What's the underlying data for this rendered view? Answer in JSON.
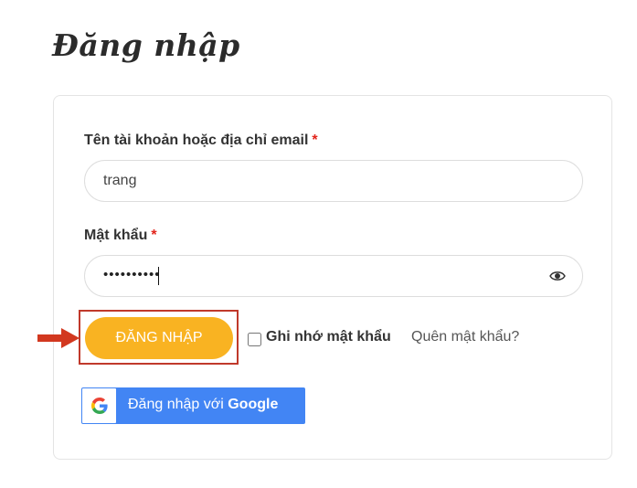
{
  "page": {
    "title": "Đăng nhập"
  },
  "form": {
    "username": {
      "label": "Tên tài khoản hoặc địa chỉ email",
      "required_mark": "*",
      "value": "trang"
    },
    "password": {
      "label": "Mật khẩu",
      "required_mark": "*",
      "masked_value": "••••••••••",
      "show_icon": "eye-icon"
    },
    "submit_label": "ĐĂNG NHẬP",
    "remember_label": "Ghi nhớ mật khẩu",
    "remember_checked": false,
    "forgot_label": "Quên mật khẩu?",
    "google": {
      "label_prefix": "Đăng nhập với ",
      "label_brand": "Google",
      "icon": "google-logo-icon"
    }
  },
  "annotation": {
    "highlight_color": "#c0392b",
    "arrow_color": "#d2381f"
  },
  "colors": {
    "primary_button": "#f9b322",
    "google_button": "#4285f4",
    "required": "#e2231a"
  }
}
